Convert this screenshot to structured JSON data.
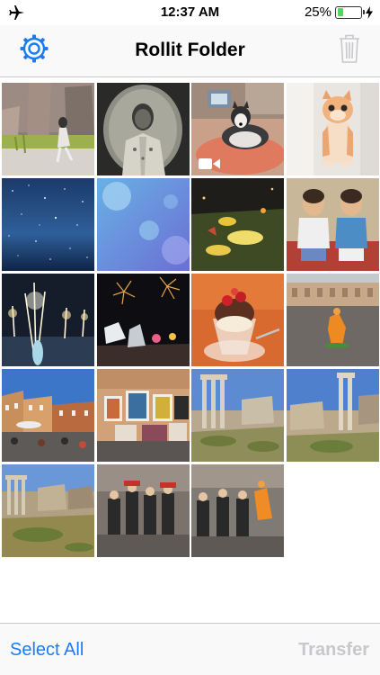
{
  "status_bar": {
    "time": "12:37 AM",
    "battery_percent": "25%",
    "battery_level": 0.25,
    "mode_icon": "airplane-icon",
    "charging_icon": "bolt-icon"
  },
  "nav": {
    "title": "Rollit Folder",
    "left_icon": "settings-gear-icon",
    "right_icon": "trash-icon"
  },
  "toolbar": {
    "select_all_label": "Select All",
    "transfer_label": "Transfer"
  },
  "colors": {
    "accent": "#1a7cf5",
    "disabled": "#c7c7cc",
    "battery": "#4cd964"
  },
  "photos": [
    {
      "subject": "photo-girl-painted-wall",
      "video": false
    },
    {
      "subject": "photo-vintage-portrait",
      "video": false
    },
    {
      "subject": "photo-husky-dog",
      "video": true
    },
    {
      "subject": "photo-kitten",
      "video": false
    },
    {
      "subject": "photo-starry-sky",
      "video": false
    },
    {
      "subject": "photo-blue-bokeh",
      "video": false
    },
    {
      "subject": "photo-night-street-art",
      "video": false
    },
    {
      "subject": "photo-two-children",
      "video": false
    },
    {
      "subject": "photo-fireworks-wedding",
      "video": false
    },
    {
      "subject": "photo-fireworks-night",
      "video": false
    },
    {
      "subject": "photo-ice-cream-dessert",
      "video": false
    },
    {
      "subject": "photo-city-square-performer",
      "video": false
    },
    {
      "subject": "photo-piazza-market",
      "video": false
    },
    {
      "subject": "photo-street-paintings",
      "video": false
    },
    {
      "subject": "photo-roman-forum-1",
      "video": false
    },
    {
      "subject": "photo-roman-forum-2",
      "video": false
    },
    {
      "subject": "photo-roman-forum-3",
      "video": false
    },
    {
      "subject": "photo-street-performers-1",
      "video": false
    },
    {
      "subject": "photo-street-performers-2",
      "video": false
    }
  ]
}
